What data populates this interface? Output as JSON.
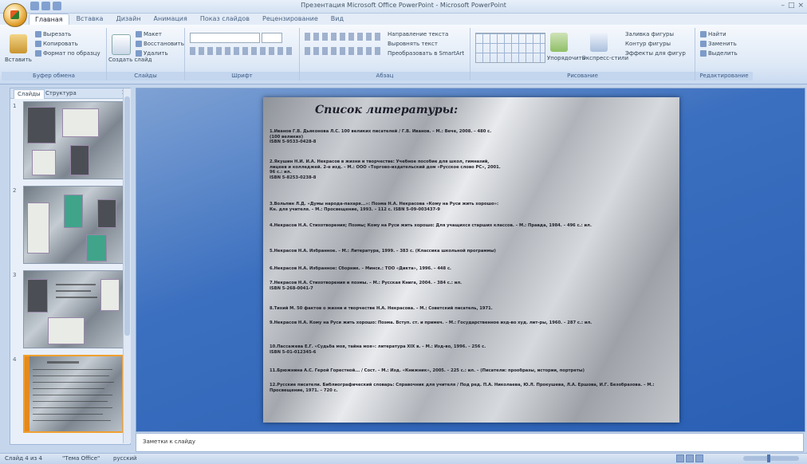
{
  "window_title": "Презентация Microsoft Office PowerPoint - Microsoft PowerPoint",
  "tabs": [
    {
      "label": "Главная",
      "active": true
    },
    {
      "label": "Вставка"
    },
    {
      "label": "Дизайн"
    },
    {
      "label": "Анимация"
    },
    {
      "label": "Показ слайдов"
    },
    {
      "label": "Рецензирование"
    },
    {
      "label": "Вид"
    }
  ],
  "ribbon": {
    "clipboard": {
      "label": "Буфер обмена",
      "paste": "Вставить",
      "cut": "Вырезать",
      "copy": "Копировать",
      "format": "Формат по образцу"
    },
    "slides": {
      "label": "Слайды",
      "new_slide": "Создать слайд",
      "layout": "Макет",
      "reset": "Восстановить",
      "delete": "Удалить"
    },
    "font": {
      "label": "Шрифт"
    },
    "paragraph": {
      "label": "Абзац",
      "direction": "Направление текста",
      "align": "Выровнять текст",
      "smartart": "Преобразовать в SmartArt"
    },
    "drawing": {
      "label": "Рисование",
      "arrange": "Упорядочить",
      "quick_styles": "Экспресс-стили",
      "fill": "Заливка фигуры",
      "outline": "Контур фигуры",
      "effects": "Эффекты для фигур"
    },
    "editing": {
      "label": "Редактирование",
      "find": "Найти",
      "replace": "Заменить",
      "select": "Выделить"
    }
  },
  "panel": {
    "tab_slides": "Слайды",
    "tab_outline": "Структура",
    "close": "×"
  },
  "thumbs": [
    {
      "num": "1"
    },
    {
      "num": "2"
    },
    {
      "num": "3"
    },
    {
      "num": "4"
    }
  ],
  "slide": {
    "title": "Список литературы:",
    "refs": [
      "1.Иванов Г.В. Дьяконова Л.С. 100 великих писателей / Г.В. Иванов. – М.: Вече, 2008. – 480 с.\n(100 великих)\nISBN 5-9533-0428-8",
      "2.Якушин Н.И. И.А. Некрасов в жизни и творчестве: Учебное пособие для школ, гимназий,\nлицеев и колледжей. 2-е изд. – М.: ООО «Торгово-издательский дом «Русское слово РС», 2001.\n96 с.: ил.\nISBN 5-8253-0238-8",
      "3.Вольпин Л.Д. «Думы народа-пахаря...»: Поэма Н.А. Некрасова «Кому на Руси жить хорошо»:\nКн. для учителя. – М.: Просвещение, 1993. – 112 с. ISBN 5-09-003437-9",
      "4.Некрасов Н.А. Стихотворения; Поэмы; Кому на Руси жить хорошо: Для учащихся старших классов. – М.: Правда, 1984. – 496 с.: ил.",
      "5.Некрасов Н.А. Избранное. – М.: Литература, 1999. – 383 с. (Классика школьной программы)",
      "6.Некрасов Н.А. Избранное: Сборник. – Минск.: ТОО «Дикта», 1996. – 448 с.",
      "7.Некрасов Н.А. Стихотворения и поэмы. – М.: Русская Книга, 2004. – 384 с.: ил.\nISBN 5-268-0041-7",
      "8.Тихий М. 50 фактов о жизни и творчестве Н.А. Некрасова. – М.: Советский писатель, 1971.",
      "9.Некрасов Н.А. Кому на Руси жить хорошо: Поэма. Вступ. ст. и примеч. – М.: Государственное изд-во худ. лит-ры, 1960. – 287 с.: ил.",
      "10.Пассажева Е.Г. «Судьба моя, тайна моя»: литература ХIХ в. – М.: Изд-во, 1996. – 256 с.\nISBN 5-01-012345-6",
      "11.Брюжнина А.С. Герой Горестной... / Сост. – М.: Изд. «Книжник», 2005. – 225 с.: ил. – (Писатели: прообразы, истории, портреты)",
      "12.Русские писатели. Библиографический словарь: Справочник для учителя / Под ред. П.А. Николаева, Ю.Л. Прокушева, Л.А. Ершова, И.Г. Безобразова. – М.: Просвещение, 1971. – 720 с."
    ]
  },
  "notes_placeholder": "Заметки к слайду",
  "status": {
    "slide_info": "Слайд 4 из 4",
    "theme": "\"Тема Office\"",
    "language": "русский"
  }
}
